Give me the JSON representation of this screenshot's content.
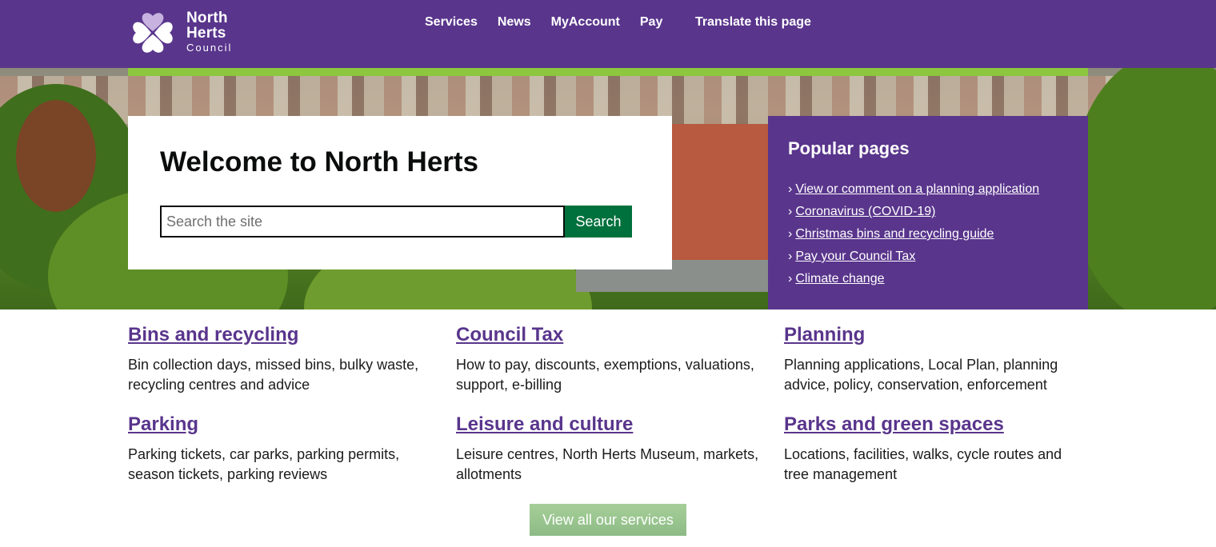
{
  "header": {
    "logo": {
      "line1": "North",
      "line2": "Herts",
      "line3": "Council"
    },
    "nav": [
      {
        "label": "Services"
      },
      {
        "label": "News"
      },
      {
        "label": "MyAccount"
      },
      {
        "label": "Pay"
      }
    ],
    "translate": "Translate this page"
  },
  "hero": {
    "welcome_title": "Welcome to North Herts",
    "search": {
      "placeholder": "Search the site",
      "value": "",
      "button_label": "Search"
    },
    "popular": {
      "title": "Popular pages",
      "links": [
        {
          "label": "View or comment on a planning application"
        },
        {
          "label": "Coronavirus (COVID-19)"
        },
        {
          "label": "Christmas bins and recycling guide"
        },
        {
          "label": "Pay your Council Tax"
        },
        {
          "label": "Climate change"
        }
      ]
    }
  },
  "services": [
    {
      "title": "Bins and recycling",
      "description": "Bin collection days, missed bins, bulky waste, recycling centres and advice"
    },
    {
      "title": "Council Tax",
      "description": "How to pay, discounts, exemptions, valuations, support, e-billing"
    },
    {
      "title": "Planning",
      "description": "Planning applications, Local Plan, planning advice, policy, conservation, enforcement"
    },
    {
      "title": "Parking",
      "description": "Parking tickets, car parks, parking permits, season tickets, parking reviews"
    },
    {
      "title": "Leisure and culture",
      "description": "Leisure centres, North Herts Museum, markets, allotments"
    },
    {
      "title": "Parks and green spaces",
      "description": "Locations, facilities, walks, cycle routes and tree management"
    }
  ],
  "view_all_label": "View all our services",
  "colors": {
    "brand_purple": "#59358c",
    "accent_green": "#8dc63f",
    "search_green": "#00703c"
  }
}
